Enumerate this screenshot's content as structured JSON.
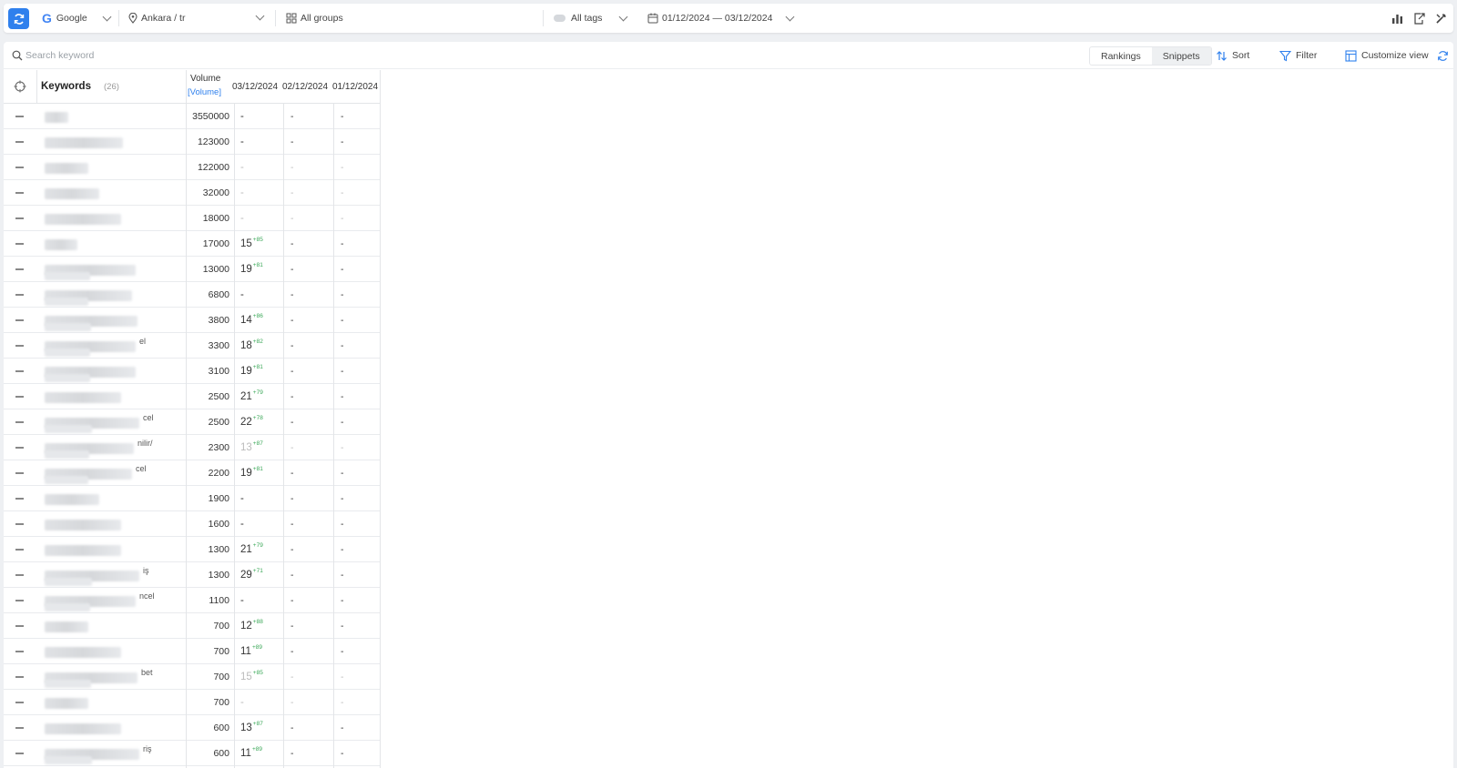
{
  "toolbar": {
    "search_engine": "Google",
    "location": "Ankara / tr",
    "groups": "All groups",
    "tags": "All tags",
    "date_range": "01/12/2024 — 03/12/2024"
  },
  "actions": {
    "search_placeholder": "Search keyword",
    "rankings_label": "Rankings",
    "snippets_label": "Snippets",
    "sort_label": "Sort",
    "filter_label": "Filter",
    "customize_label": "Customize view"
  },
  "table": {
    "keywords_label": "Keywords",
    "keyword_count": "(26)",
    "volume_label": "Volume",
    "volume_link": "[Volume]",
    "dates": [
      "03/12/2024",
      "02/12/2024",
      "01/12/2024"
    ],
    "rows": [
      {
        "suffix": "",
        "volume": "3550000",
        "pos": "-",
        "delta": "",
        "d2": "-",
        "d3": "-"
      },
      {
        "suffix": "",
        "volume": "123000",
        "pos": "-",
        "delta": "",
        "d2": "-",
        "d3": "-"
      },
      {
        "suffix": "",
        "volume": "122000",
        "pos": "-",
        "delta": "",
        "d2": "-",
        "d3": "-"
      },
      {
        "suffix": "",
        "volume": "32000",
        "pos": "-",
        "delta": "",
        "d2": "-",
        "d3": "-"
      },
      {
        "suffix": "",
        "volume": "18000",
        "pos": "-",
        "delta": "",
        "d2": "-",
        "d3": "-"
      },
      {
        "suffix": "",
        "volume": "17000",
        "pos": "15",
        "delta": "+85",
        "d2": "-",
        "d3": "-"
      },
      {
        "suffix": "",
        "volume": "13000",
        "pos": "19",
        "delta": "+81",
        "d2": "-",
        "d3": "-"
      },
      {
        "suffix": "",
        "volume": "6800",
        "pos": "-",
        "delta": "",
        "d2": "-",
        "d3": "-"
      },
      {
        "suffix": "",
        "volume": "3800",
        "pos": "14",
        "delta": "+86",
        "d2": "-",
        "d3": "-"
      },
      {
        "suffix": "el",
        "volume": "3300",
        "pos": "18",
        "delta": "+82",
        "d2": "-",
        "d3": "-"
      },
      {
        "suffix": "",
        "volume": "3100",
        "pos": "19",
        "delta": "+81",
        "d2": "-",
        "d3": "-"
      },
      {
        "suffix": "",
        "volume": "2500",
        "pos": "21",
        "delta": "+79",
        "d2": "-",
        "d3": "-"
      },
      {
        "suffix": "cel",
        "volume": "2500",
        "pos": "22",
        "delta": "+78",
        "d2": "-",
        "d3": "-"
      },
      {
        "suffix": "nilir/",
        "volume": "2300",
        "pos": "13",
        "delta": "+87",
        "d2": "-",
        "d3": "-"
      },
      {
        "suffix": "cel",
        "volume": "2200",
        "pos": "19",
        "delta": "+81",
        "d2": "-",
        "d3": "-"
      },
      {
        "suffix": "",
        "volume": "1900",
        "pos": "-",
        "delta": "",
        "d2": "-",
        "d3": "-"
      },
      {
        "suffix": "",
        "volume": "1600",
        "pos": "-",
        "delta": "",
        "d2": "-",
        "d3": "-"
      },
      {
        "suffix": "",
        "volume": "1300",
        "pos": "21",
        "delta": "+79",
        "d2": "-",
        "d3": "-"
      },
      {
        "suffix": "iş",
        "volume": "1300",
        "pos": "29",
        "delta": "+71",
        "d2": "-",
        "d3": "-"
      },
      {
        "suffix": "ncel",
        "volume": "1100",
        "pos": "-",
        "delta": "",
        "d2": "-",
        "d3": "-"
      },
      {
        "suffix": "",
        "volume": "700",
        "pos": "12",
        "delta": "+88",
        "d2": "-",
        "d3": "-"
      },
      {
        "suffix": "",
        "volume": "700",
        "pos": "11",
        "delta": "+89",
        "d2": "-",
        "d3": "-"
      },
      {
        "suffix": "bet",
        "volume": "700",
        "pos": "15",
        "delta": "+85",
        "d2": "-",
        "d3": "-"
      },
      {
        "suffix": "",
        "volume": "700",
        "pos": "-",
        "delta": "",
        "d2": "-",
        "d3": "-"
      },
      {
        "suffix": "",
        "volume": "600",
        "pos": "13",
        "delta": "+87",
        "d2": "-",
        "d3": "-"
      },
      {
        "suffix": "riş",
        "volume": "600",
        "pos": "11",
        "delta": "+89",
        "d2": "-",
        "d3": "-"
      }
    ]
  },
  "colors": {
    "brand": "#2f80ed",
    "positive_delta": "#3aa757",
    "link": "#2f80ed"
  }
}
